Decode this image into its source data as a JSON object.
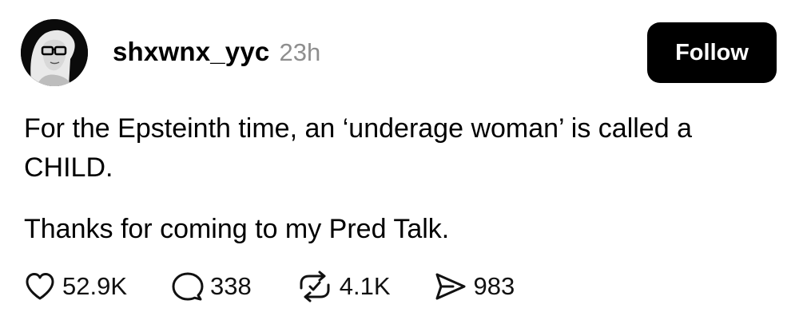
{
  "post": {
    "author": {
      "username": "shxwnx_yyc",
      "avatar_icon": "profile-avatar"
    },
    "timestamp": "23h",
    "follow_label": "Follow",
    "text": {
      "line1": "For the Epsteinth time, an ‘underage woman’ is called a CHILD.",
      "line2": "Thanks for coming to my Pred Talk."
    },
    "actions": {
      "likes": "52.9K",
      "replies": "338",
      "reposts": "4.1K",
      "shares": "983"
    }
  }
}
